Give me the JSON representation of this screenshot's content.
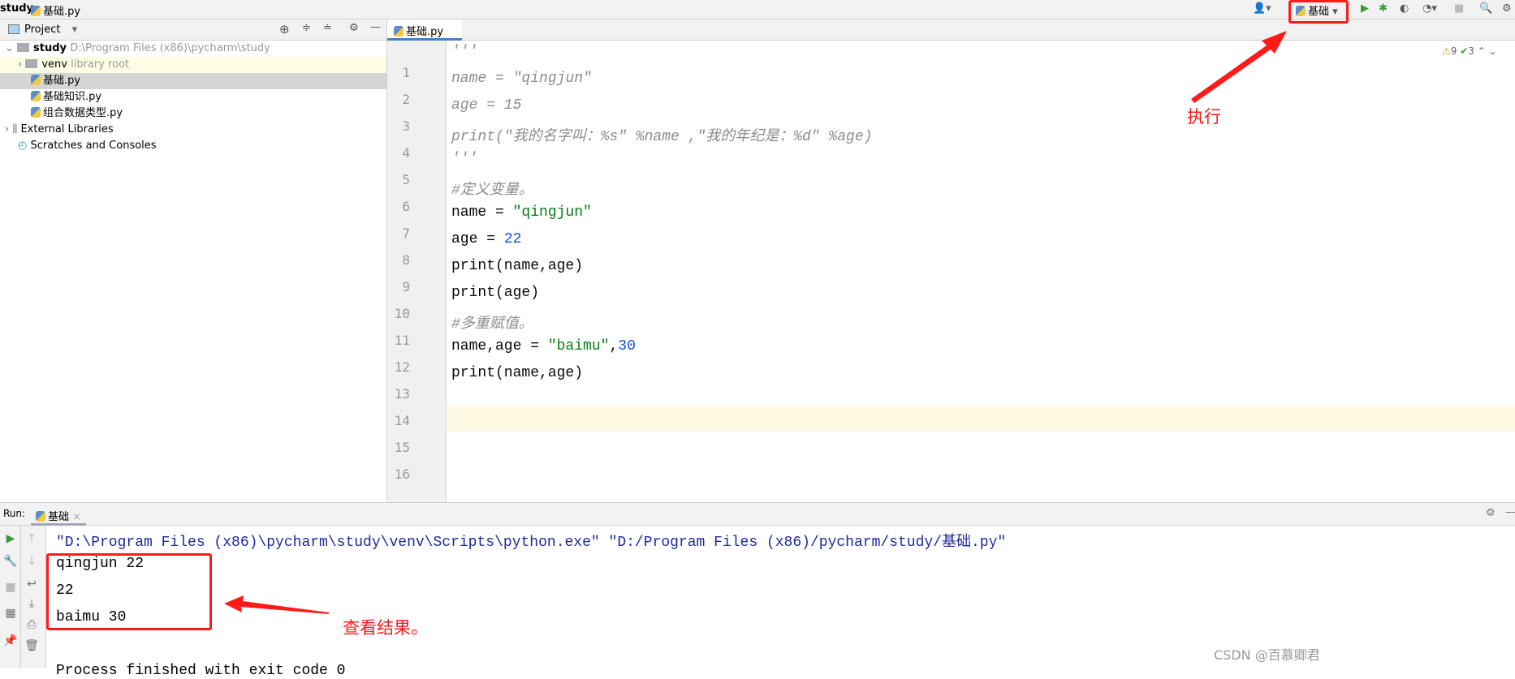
{
  "breadcrumb": {
    "project": "study",
    "file": "基础.py"
  },
  "run_config": {
    "name": "基础"
  },
  "sidebar": {
    "title": "Project",
    "tree": [
      {
        "label": "study",
        "hint": "D:\\Program Files (x86)\\pycharm\\study"
      },
      {
        "label": "venv",
        "hint": "library root"
      },
      {
        "label": "基础.py"
      },
      {
        "label": "基础知识.py"
      },
      {
        "label": "组合数据类型.py"
      },
      {
        "label": "External Libraries"
      },
      {
        "label": "Scratches and Consoles"
      }
    ]
  },
  "editor": {
    "tab": "基础.py",
    "warnings": "9",
    "checks": "3",
    "line_numbers": [
      "1",
      "2",
      "3",
      "4",
      "5",
      "6",
      "7",
      "8",
      "9",
      "10",
      "11",
      "12",
      "13",
      "14",
      "15",
      "16"
    ]
  },
  "run": {
    "label": "Run:",
    "tab": "基础",
    "command": "\"D:\\Program Files (x86)\\pycharm\\study\\venv\\Scripts\\python.exe\" \"D:/Program Files (x86)/pycharm/study/基础.py\"",
    "output": [
      "qingjun 22",
      "22",
      "baimu 30"
    ],
    "finish": "Process finished with exit code 0"
  },
  "annotations": {
    "execute": "执行",
    "view_result": "查看结果。"
  },
  "watermark": "CSDN @百慕卿君",
  "colors": {
    "accent": "#4083c9",
    "annotation": "#ff1a1a",
    "string": "#067d17",
    "number": "#1750eb"
  }
}
